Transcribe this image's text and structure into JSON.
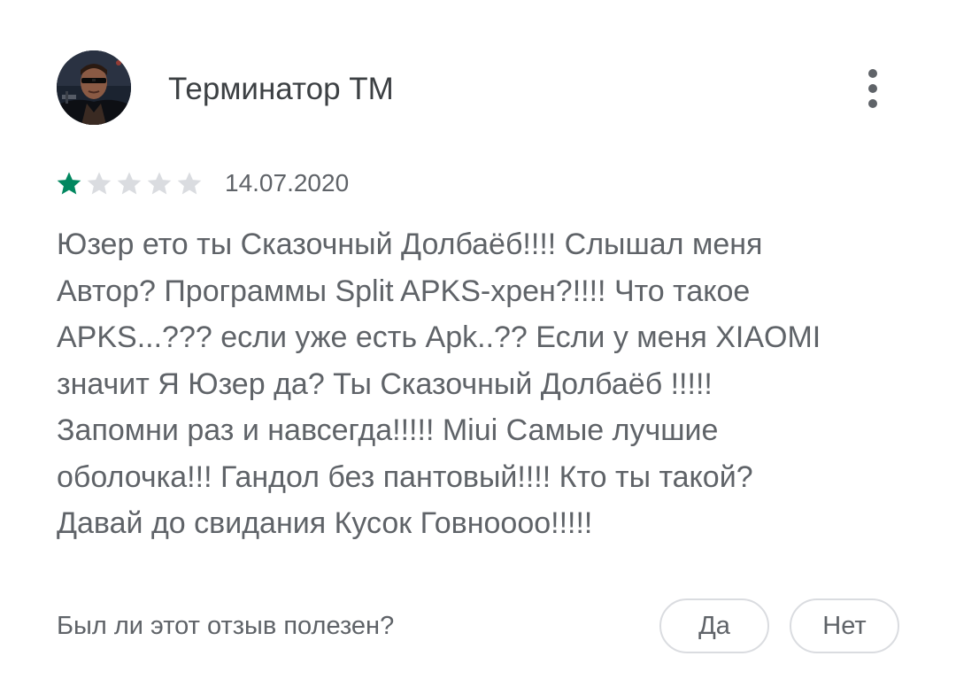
{
  "review": {
    "author": "Терминатор ТМ",
    "avatar_icon": "terminator-avatar",
    "menu_icon": "more-vert-icon",
    "rating": 1,
    "max_rating": 5,
    "date": "14.07.2020",
    "text_lines": [
      "Юзер ето ты Сказочный Долбаёб!!!! Слышал меня",
      "Автор? Программы Split APKS-хрен?!!!! Что такое",
      "APKS...??? если уже есть Apk..?? Если у меня XIAOMI",
      "значит Я Юзер да? Ты Сказочный Долбаёб !!!!!",
      "Запомни раз и навсегда!!!!! Miui Самые лучшие",
      "оболочка!!! Гандол без пантовый!!!! Кто ты такой?",
      "Давай до свидания Кусок Говноооо!!!!!"
    ]
  },
  "feedback": {
    "question": "Был ли этот отзыв полезен?",
    "yes_label": "Да",
    "no_label": "Нет"
  },
  "colors": {
    "star_filled": "#01875f",
    "star_empty": "#dadce0",
    "text": "#5f6368",
    "name": "#3c4043",
    "button_border": "#dadce0"
  }
}
